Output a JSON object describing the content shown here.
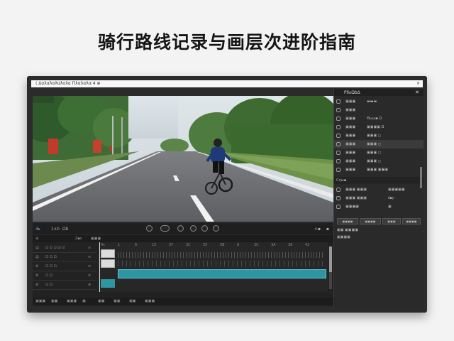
{
  "headline": "骑行路线记录与画层次进阶指南",
  "window": {
    "title": "⟨ Δαλαλαλαλαλα  Πλαλαλα:4 ⊕",
    "close": "×"
  },
  "viewer": {
    "scene": "cyclist-on-road"
  },
  "transport": {
    "timecode": "4▸",
    "left_a": "1∧b",
    "left_b": "Ωb",
    "right_a": "<▪",
    "right_b": "▪"
  },
  "timeline": {
    "head": [
      "⊕",
      "Z▪s",
      "▣▣▣"
    ],
    "ruler": [
      "4s",
      "1",
      "6",
      "15",
      "3Y",
      "3C",
      "35",
      "5B",
      "8",
      "3C",
      "3A",
      "36",
      "42"
    ],
    "tracks": [
      {
        "icon": "▤",
        "name": "⊡ ⊡ ⊡ ⊡ ⊡",
        "extra": "≡"
      },
      {
        "icon": "▤",
        "name": "⊡ ⊡ ⊡",
        "extra": "≡"
      },
      {
        "icon": "⊗",
        "name": "⊡ ⊡ ⊡",
        "extra": "≡"
      },
      {
        "icon": "⊗",
        "name": "⊡ ⊡",
        "extra": "≡"
      },
      {
        "icon": "⊗",
        "name": "⊡ ⊡",
        "extra": "⊕"
      }
    ],
    "footer": [
      "▣▣▣",
      "▣▣",
      "▣▣▣",
      "▣",
      "▣▣",
      "▣▣",
      "▣▣",
      "▣▣▣"
    ]
  },
  "panel": {
    "title": "PliεΩbΔ",
    "close": "✕",
    "rows": [
      {
        "label": "▣▣▣",
        "value": "▬▬▬"
      },
      {
        "label": "▣▣▣",
        "value": ""
      },
      {
        "label": "▣▣▣",
        "value": "Θωω▪ Ω"
      },
      {
        "label": "▣▣▣",
        "value": "▣▣▣▣ Ω"
      },
      {
        "label": "▣▣▣",
        "value": "▣▣▣ ◻"
      },
      {
        "label": "▣▣▣",
        "value": "▣▣▣ ◻"
      },
      {
        "label": "▣▣▣",
        "value": "▣▣▣ ◻"
      },
      {
        "label": "▣▣▣",
        "value": "▣▣▣ ◻"
      },
      {
        "label": "▣▣▣",
        "value": "▣▣▣ ▣▣▣"
      }
    ],
    "section_label": "Cηω▪",
    "section_rows": [
      {
        "a": "▣▣▣ ▣▣▣",
        "b": "▣▣▣▣▣"
      },
      {
        "a": "▣▣▣ ▣▣▣",
        "b": "ℓ▪y"
      },
      {
        "a": "▣▣▣▣",
        "b": "▣"
      }
    ],
    "buttons": [
      "▣▣▣▣",
      "▣▣▣▣",
      "▣▣▣",
      "▣▣▣▣"
    ],
    "bottom_a": "▣▣ ▣▣▣▣",
    "bottom_b": "▣▣▣▣"
  }
}
